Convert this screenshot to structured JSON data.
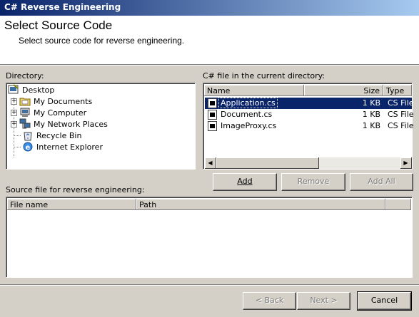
{
  "window": {
    "title": "C# Reverse Engineering"
  },
  "header": {
    "title": "Select Source Code",
    "subtitle": "Select source code for reverse engineering."
  },
  "directory": {
    "label": "Directory:",
    "items": [
      {
        "label": "Desktop",
        "icon": "desktop-icon",
        "expandable": false
      },
      {
        "label": "My Documents",
        "icon": "folder-icon",
        "expandable": true
      },
      {
        "label": "My Computer",
        "icon": "computer-icon",
        "expandable": true
      },
      {
        "label": "My Network Places",
        "icon": "network-icon",
        "expandable": true
      },
      {
        "label": "Recycle Bin",
        "icon": "recycle-bin-icon",
        "expandable": false
      },
      {
        "label": "Internet Explorer",
        "icon": "internet-explorer-icon",
        "expandable": false
      }
    ]
  },
  "files": {
    "label": "C# file in the current directory:",
    "columns": {
      "name": "Name",
      "size": "Size",
      "type": "Type"
    },
    "rows": [
      {
        "name": "Application.cs",
        "size": "1 KB",
        "type": "CS File",
        "selected": true
      },
      {
        "name": "Document.cs",
        "size": "1 KB",
        "type": "CS File",
        "selected": false
      },
      {
        "name": "ImageProxy.cs",
        "size": "1 KB",
        "type": "CS File",
        "selected": false
      }
    ],
    "scroll_left": "◀",
    "scroll_right": "▶"
  },
  "actions": {
    "add": "Add",
    "remove": "Remove",
    "add_all": "Add All"
  },
  "source": {
    "label": "Source file for reverse engineering:",
    "columns": {
      "file_name": "File name",
      "path": "Path"
    }
  },
  "footer": {
    "back": "< Back",
    "next": "Next >",
    "cancel": "Cancel"
  },
  "colors": {
    "title_start": "#0a246a",
    "title_end": "#a6caf0",
    "selection": "#0a246a",
    "face": "#d4d0c8"
  }
}
